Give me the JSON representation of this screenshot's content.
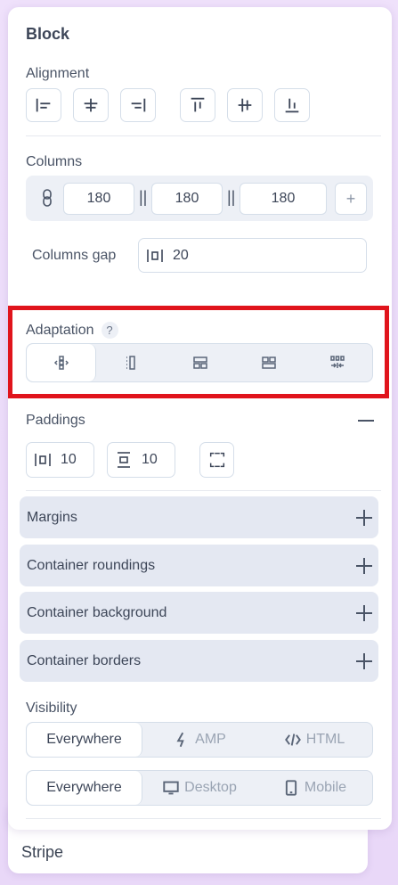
{
  "panel": {
    "title": "Block"
  },
  "alignment": {
    "label": "Alignment",
    "buttons": [
      "align-left-icon",
      "align-center-horizontal-icon",
      "align-right-icon",
      "align-top-icon",
      "align-middle-vertical-icon",
      "align-bottom-icon"
    ]
  },
  "columns": {
    "label": "Columns",
    "values": [
      "180",
      "180",
      "180"
    ],
    "separator": "||",
    "add_label": "+",
    "gap_label": "Columns gap",
    "gap_value": "20"
  },
  "adaptation": {
    "label": "Adaptation",
    "help": "?",
    "options": [
      "stack-icon",
      "column-dots-icon",
      "two-rows-icon",
      "grid-icon",
      "shrink-icon"
    ],
    "active_index": 0
  },
  "paddings": {
    "label": "Paddings",
    "horizontal": "10",
    "vertical": "10"
  },
  "sections": {
    "margins": "Margins",
    "container_roundings": "Container roundings",
    "container_background": "Container background",
    "container_borders": "Container borders"
  },
  "visibility": {
    "label": "Visibility",
    "row1": [
      "Everywhere",
      "AMP",
      "HTML"
    ],
    "row2": [
      "Everywhere",
      "Desktop",
      "Mobile"
    ]
  },
  "stripe": {
    "label": "Stripe"
  },
  "colors": {
    "accent_red": "#e0141c",
    "panel_bg": "#ffffff",
    "page_bg": "#efe1fb"
  }
}
